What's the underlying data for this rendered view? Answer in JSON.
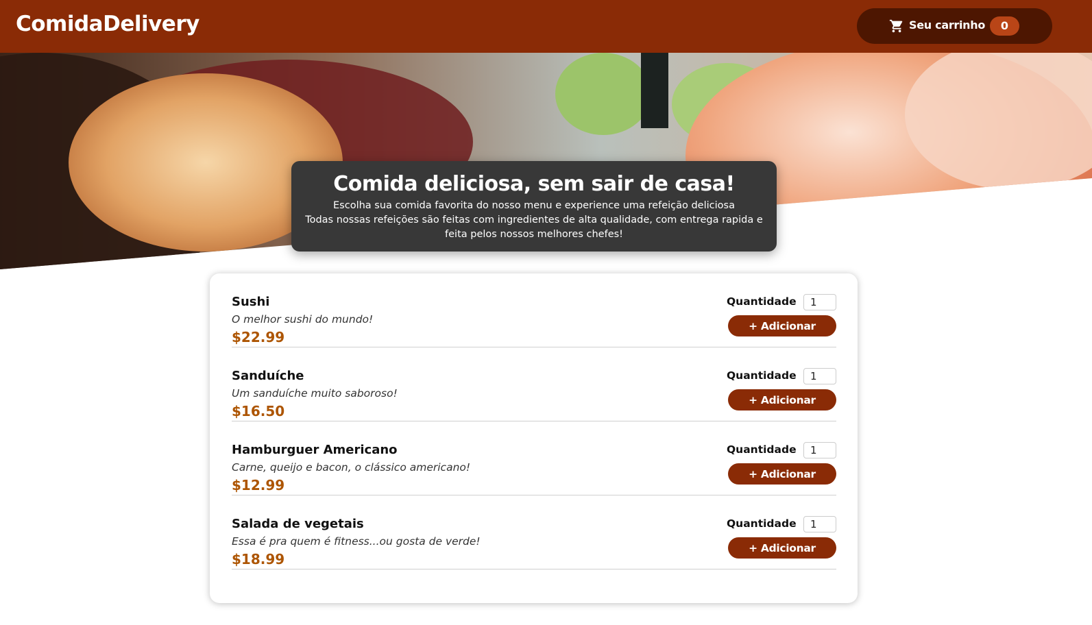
{
  "header": {
    "logo": "ComidaDelivery",
    "cart": {
      "label": "Seu carrinho",
      "count": "0",
      "icon": "cart-icon"
    }
  },
  "hero": {
    "image": "sushi-photo"
  },
  "summary": {
    "title": "Comida deliciosa, sem sair de casa!",
    "line1": "Escolha sua comida favorita do nosso menu e experience uma refeição deliciosa",
    "line2": "Todas nossas refeições são feitas com ingredientes de alta qualidade, com entrega rapida e feita pelos nossos melhores chefes!"
  },
  "meals": [
    {
      "name": "Sushi",
      "description": "O melhor sushi do mundo!",
      "price": "$22.99",
      "quantity_label": "Quantidade",
      "quantity": "1",
      "add_label": "+ Adicionar"
    },
    {
      "name": "Sanduíche",
      "description": "Um sanduíche muito saboroso!",
      "price": "$16.50",
      "quantity_label": "Quantidade",
      "quantity": "1",
      "add_label": "+ Adicionar"
    },
    {
      "name": "Hamburguer Americano",
      "description": "Carne, queijo e bacon, o clássico americano!",
      "price": "$12.99",
      "quantity_label": "Quantidade",
      "quantity": "1",
      "add_label": "+ Adicionar"
    },
    {
      "name": "Salada de vegetais",
      "description": "Essa é pra quem é fitness...ou gosta de verde!",
      "price": "$18.99",
      "quantity_label": "Quantidade",
      "quantity": "1",
      "add_label": "+ Adicionar"
    }
  ],
  "colors": {
    "header": "#8a2b06",
    "cart_button": "#4d1601",
    "cart_badge": "#b94517",
    "price": "#ad5502",
    "summary_bg": "#383838"
  }
}
